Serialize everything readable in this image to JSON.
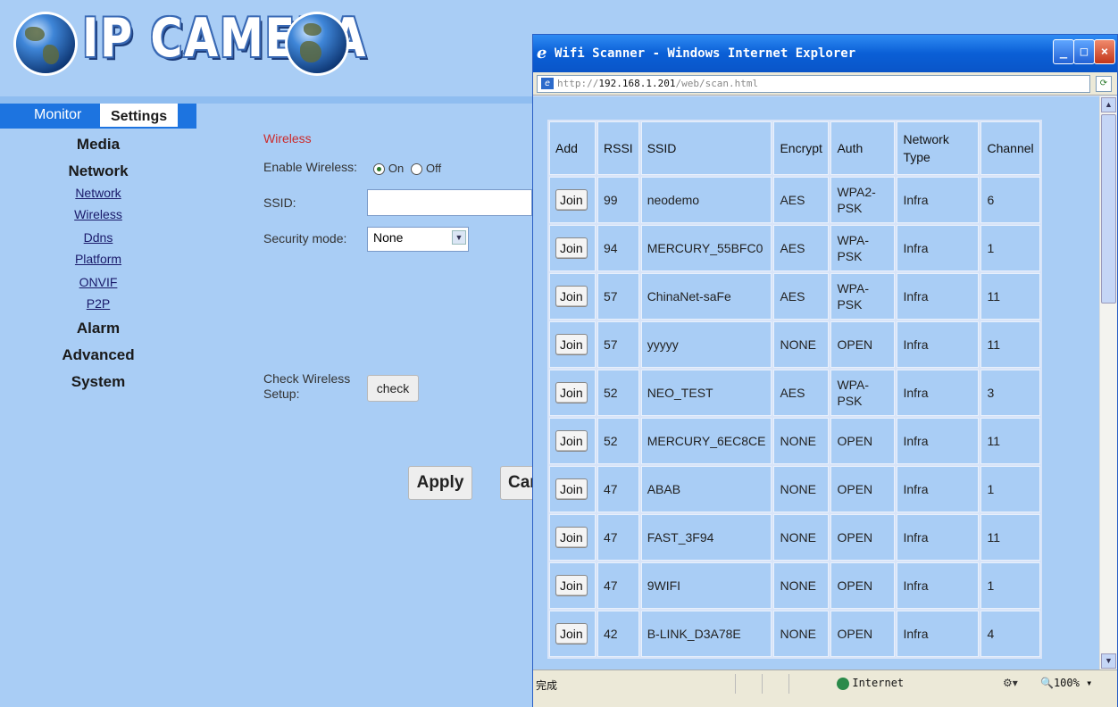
{
  "brand": {
    "logo_text": "IP CAMERA"
  },
  "tabs": {
    "monitor": "Monitor",
    "settings": "Settings"
  },
  "sidebar": {
    "media": "Media",
    "network": "Network",
    "links": [
      "Network",
      "Wireless",
      "Ddns",
      "Platform",
      "ONVIF",
      "P2P"
    ],
    "alarm": "Alarm",
    "advanced": "Advanced",
    "system": "System"
  },
  "form": {
    "section_title": "Wireless",
    "enable_label": "Enable Wireless:",
    "on_label": "On",
    "off_label": "Off",
    "ssid_label": "SSID:",
    "ssid_value": "",
    "security_label": "Security mode:",
    "security_value": "None",
    "check_label_1": "Check Wireless",
    "check_label_2": "Setup:",
    "check_button": "check",
    "apply_button": "Apply",
    "cancel_button": "Car"
  },
  "popup": {
    "title": "Wifi Scanner - Windows Internet Explorer",
    "url_prefix": "http://",
    "url_host": "192.168.1.201",
    "url_path": "/web/scan.html",
    "status_left": "完成",
    "status_zone": "Internet",
    "zoom": "100%",
    "table": {
      "headers": [
        "Add",
        "RSSI",
        "SSID",
        "Encrypt",
        "Auth",
        "Network Type",
        "Channel"
      ],
      "join_label": "Join",
      "rows": [
        {
          "rssi": "99",
          "ssid": "neodemo",
          "encrypt": "AES",
          "auth": "WPA2-PSK",
          "type": "Infra",
          "channel": "6"
        },
        {
          "rssi": "94",
          "ssid": "MERCURY_55BFC0",
          "encrypt": "AES",
          "auth": "WPA-PSK",
          "type": "Infra",
          "channel": "1"
        },
        {
          "rssi": "57",
          "ssid": "ChinaNet-saFe",
          "encrypt": "AES",
          "auth": "WPA-PSK",
          "type": "Infra",
          "channel": "11"
        },
        {
          "rssi": "57",
          "ssid": "yyyyy",
          "encrypt": "NONE",
          "auth": "OPEN",
          "type": "Infra",
          "channel": "11"
        },
        {
          "rssi": "52",
          "ssid": "NEO_TEST",
          "encrypt": "AES",
          "auth": "WPA-PSK",
          "type": "Infra",
          "channel": "3"
        },
        {
          "rssi": "52",
          "ssid": "MERCURY_6EC8CE",
          "encrypt": "NONE",
          "auth": "OPEN",
          "type": "Infra",
          "channel": "11"
        },
        {
          "rssi": "47",
          "ssid": "ABAB",
          "encrypt": "NONE",
          "auth": "OPEN",
          "type": "Infra",
          "channel": "1"
        },
        {
          "rssi": "47",
          "ssid": "FAST_3F94",
          "encrypt": "NONE",
          "auth": "OPEN",
          "type": "Infra",
          "channel": "11"
        },
        {
          "rssi": "47",
          "ssid": "9WIFI",
          "encrypt": "NONE",
          "auth": "OPEN",
          "type": "Infra",
          "channel": "1"
        },
        {
          "rssi": "42",
          "ssid": "B-LINK_D3A78E",
          "encrypt": "NONE",
          "auth": "OPEN",
          "type": "Infra",
          "channel": "4"
        }
      ]
    }
  },
  "colors": {
    "page_bg": "#a9cdf5",
    "tab_bar": "#1d74e0",
    "title_bar": "#0a5fd6",
    "section_title": "#cc2a2a"
  }
}
